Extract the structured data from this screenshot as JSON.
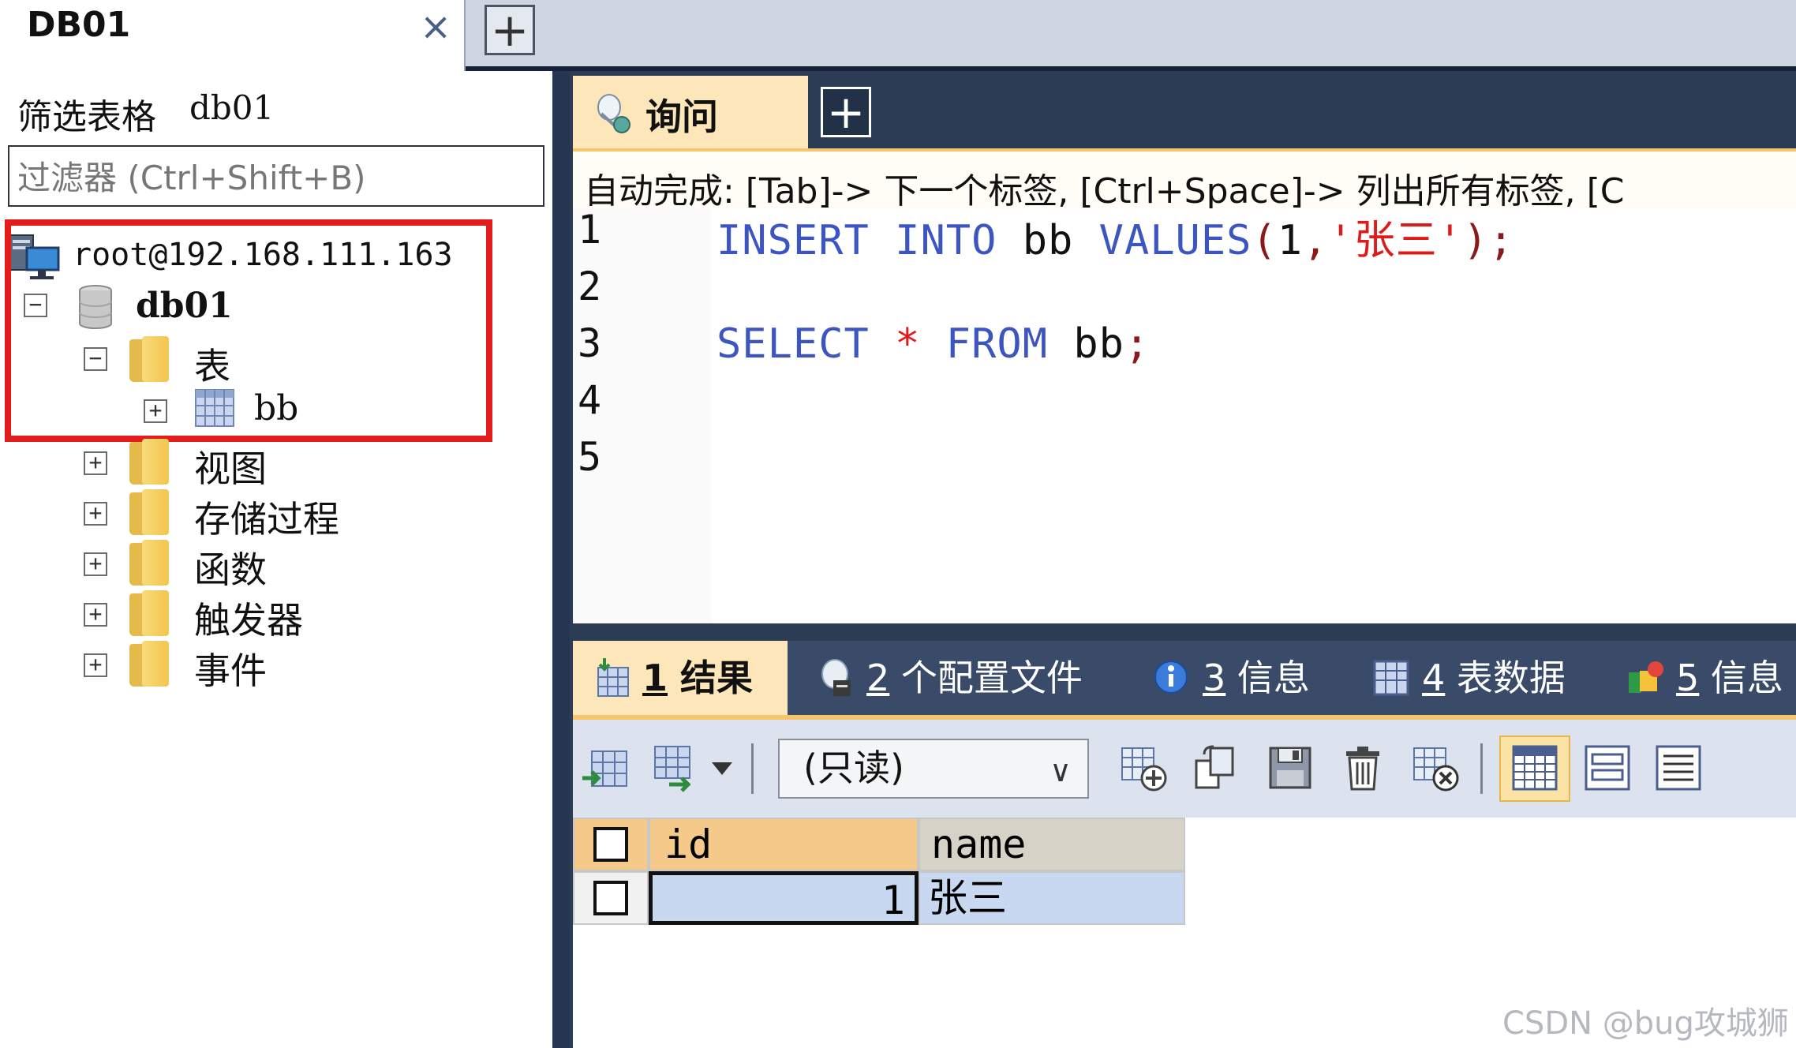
{
  "window": {
    "connection_tab": "DB01",
    "close_symbol": "×",
    "new_tab_symbol": "+"
  },
  "object_browser": {
    "filter_label": "筛选表格",
    "filter_db": "db01",
    "filter_placeholder": "过滤器 (Ctrl+Shift+B)",
    "tree": {
      "connection": "root@192.168.111.163",
      "database": "db01",
      "tables_folder": "表",
      "table": "bb",
      "views_folder": "视图",
      "procedures_folder": "存储过程",
      "functions_folder": "函数",
      "triggers_folder": "触发器",
      "events_folder": "事件"
    },
    "expand_symbol": "+",
    "collapse_symbol": "−"
  },
  "editor": {
    "query_tab_label": "询问",
    "new_query_symbol": "+",
    "autocomplete_hint": "自动完成: [Tab]-> 下一个标签, [Ctrl+Space]-> 列出所有标签, [C",
    "line_numbers": [
      "1",
      "2",
      "3",
      "4",
      "5"
    ],
    "line1": {
      "kw1": "INSERT",
      "kw2": "INTO",
      "table": "bb",
      "kw3": "VALUES",
      "open": "(",
      "num": "1",
      "comma": ",",
      "str": "'张三'",
      "close": ")",
      "semi": ";"
    },
    "line3": {
      "kw1": "SELECT",
      "star": "*",
      "kw2": "FROM",
      "table": "bb",
      "semi": ";"
    }
  },
  "results": {
    "tabs": [
      {
        "num": "1",
        "label": "结果"
      },
      {
        "num": "2",
        "label": "个配置文件"
      },
      {
        "num": "3",
        "label": "信息"
      },
      {
        "num": "4",
        "label": "表数据"
      },
      {
        "num": "5",
        "label": "信息"
      }
    ],
    "readonly_option": "(只读)",
    "dropdown_symbol": "∨",
    "columns": [
      "id",
      "name"
    ],
    "rows": [
      {
        "id": "1",
        "name": "张三"
      }
    ]
  },
  "watermark": "CSDN @bug攻城狮",
  "colors": {
    "accent_orange": "#f7c66c",
    "dark_frame": "#2d3c55",
    "highlight_red": "#e51c1c",
    "keyword_blue": "#3d55c0",
    "string_red": "#e01919"
  }
}
